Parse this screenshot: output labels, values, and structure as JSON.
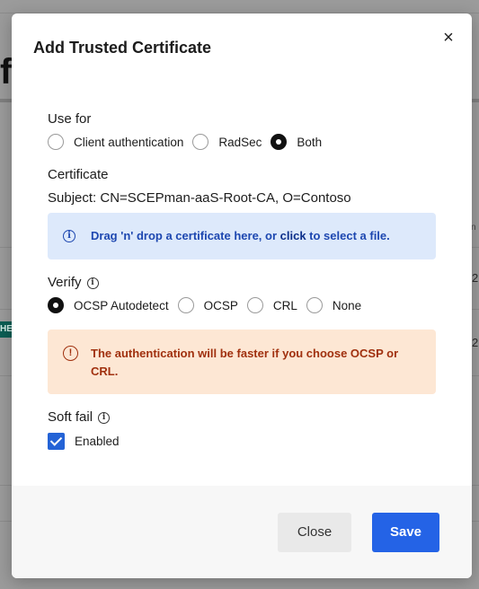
{
  "background": {
    "partial_heading": "f",
    "badge_text": "HE",
    "digits": [
      "2",
      "2"
    ],
    "small_text": "n"
  },
  "modal": {
    "title": "Add Trusted Certificate",
    "close_symbol": "×",
    "use_for": {
      "label": "Use for",
      "options": [
        {
          "label": "Client authentication",
          "checked": false
        },
        {
          "label": "RadSec",
          "checked": false
        },
        {
          "label": "Both",
          "checked": true
        }
      ]
    },
    "certificate": {
      "label": "Certificate",
      "subject": "Subject: CN=SCEPman-aaS-Root-CA, O=Contoso",
      "dropzone_text_before": "Drag 'n' drop a certificate here, or ",
      "dropzone_link": "click",
      "dropzone_text_after": " to select a file."
    },
    "verify": {
      "label": "Verify",
      "options": [
        {
          "label": "OCSP Autodetect",
          "checked": true
        },
        {
          "label": "OCSP",
          "checked": false
        },
        {
          "label": "CRL",
          "checked": false
        },
        {
          "label": "None",
          "checked": false
        }
      ],
      "warning": "The authentication will be faster if you choose OCSP or CRL."
    },
    "soft_fail": {
      "label": "Soft fail",
      "checkbox_label": "Enabled",
      "checked": true
    },
    "buttons": {
      "close": "Close",
      "save": "Save"
    }
  },
  "colors": {
    "accent": "#2463e6",
    "info_bg": "#dde9fb",
    "info_text": "#1d47b0",
    "warning_bg": "#fde7d4",
    "warning_text": "#a0300e"
  },
  "icons": {
    "close": "close-icon",
    "info": "info-icon",
    "warning": "warning-icon",
    "check": "check-icon"
  }
}
